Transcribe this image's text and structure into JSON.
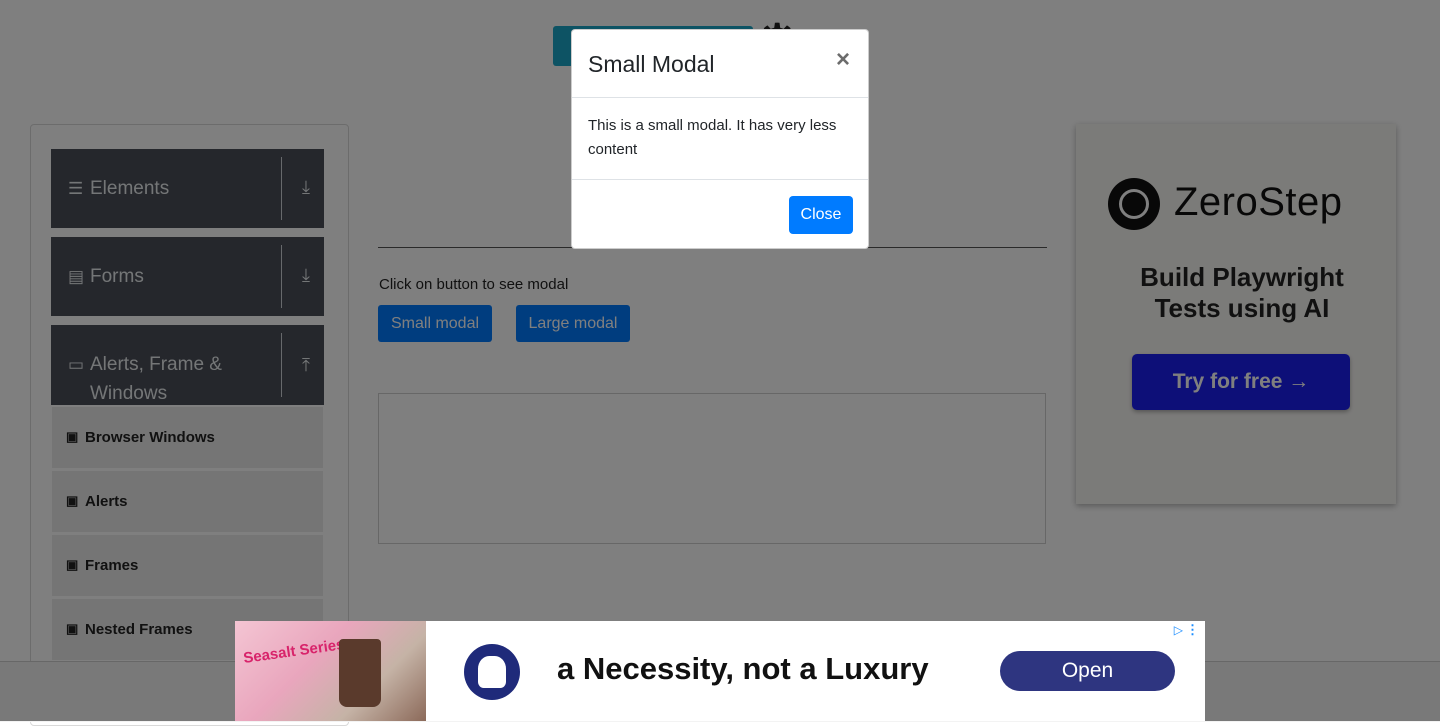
{
  "sidebar": {
    "groups": [
      {
        "label": "Elements",
        "icon": "hamburger-icon",
        "arrow": "download-icon"
      },
      {
        "label": "Forms",
        "icon": "document-icon",
        "arrow": "download-icon"
      },
      {
        "label": "Alerts, Frame & Windows",
        "icon": "window-icon",
        "arrow": "upload-icon"
      }
    ],
    "sub_items": [
      {
        "label": "Browser Windows"
      },
      {
        "label": "Alerts"
      },
      {
        "label": "Frames"
      },
      {
        "label": "Nested Frames"
      }
    ]
  },
  "main": {
    "instruction": "Click on button to see modal",
    "small_modal_button": "Small modal",
    "large_modal_button": "Large modal"
  },
  "modal": {
    "title": "Small Modal",
    "close_symbol": "×",
    "body": "This is a small modal. It has very less content",
    "close_button": "Close"
  },
  "side_ad": {
    "brand": "ZeroStep",
    "tagline": "Build Playwright Tests using AI",
    "cta": "Try for free →"
  },
  "bottom_ad": {
    "promo_text": "Seasalt Series",
    "headline": "a Necessity, not a Luxury",
    "open_button": "Open",
    "choices_symbol": "▷",
    "menu_symbol": "⋮"
  },
  "colors": {
    "primary": "#007bff",
    "sidebar_header": "#4a4f58",
    "overlay": "rgba(0,0,0,0.5)",
    "ad_cta": "#1a1ff0",
    "ad_open": "#2e3580"
  }
}
